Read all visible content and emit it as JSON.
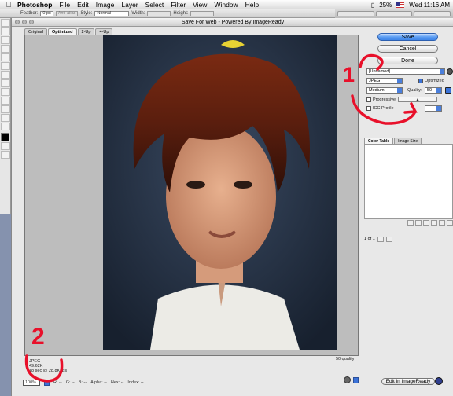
{
  "menubar": {
    "app_name": "Photoshop",
    "items": [
      "File",
      "Edit",
      "Image",
      "Layer",
      "Select",
      "Filter",
      "View",
      "Window",
      "Help"
    ],
    "battery": "25%",
    "clock": "Wed 11:16 AM"
  },
  "options_bar": {
    "feather_label": "Feather:",
    "feather_value": "0 px",
    "anti_alias": "Anti-alias",
    "style_label": "Style:",
    "style_value": "Normal",
    "width_label": "Width:",
    "height_label": "Height:"
  },
  "dialog": {
    "title": "Save For Web - Powered By ImageReady",
    "view_tabs": [
      "Original",
      "Optimized",
      "2-Up",
      "4-Up"
    ],
    "active_view_tab": "Optimized",
    "buttons": {
      "save": "Save",
      "cancel": "Cancel",
      "done": "Done"
    },
    "settings": {
      "preset": "[Unnamed]",
      "format": "JPEG",
      "optimized_label": "Optimized",
      "quality_preset": "Medium",
      "quality_label": "Quality:",
      "quality_value": "50",
      "progressive_label": "Progressive",
      "icc_label": "ICC Profile"
    },
    "panel_tabs": [
      "Color Table",
      "Image Size"
    ],
    "pager": "1 of 1",
    "image_info": {
      "format": "JPEG",
      "size": "49.62K",
      "time": "18 sec @ 28.8Kbps"
    },
    "quality_readout": "50 quality",
    "status": {
      "zoom": "100%",
      "r": "R: --",
      "g": "G: --",
      "b": "B: --",
      "alpha": "Alpha: --",
      "hex": "Hex: --",
      "index": "Index: --"
    },
    "edit_in_imageready": "Edit in ImageReady"
  },
  "annotations": {
    "one": "1",
    "two": "2",
    "color": "#e8102a"
  }
}
